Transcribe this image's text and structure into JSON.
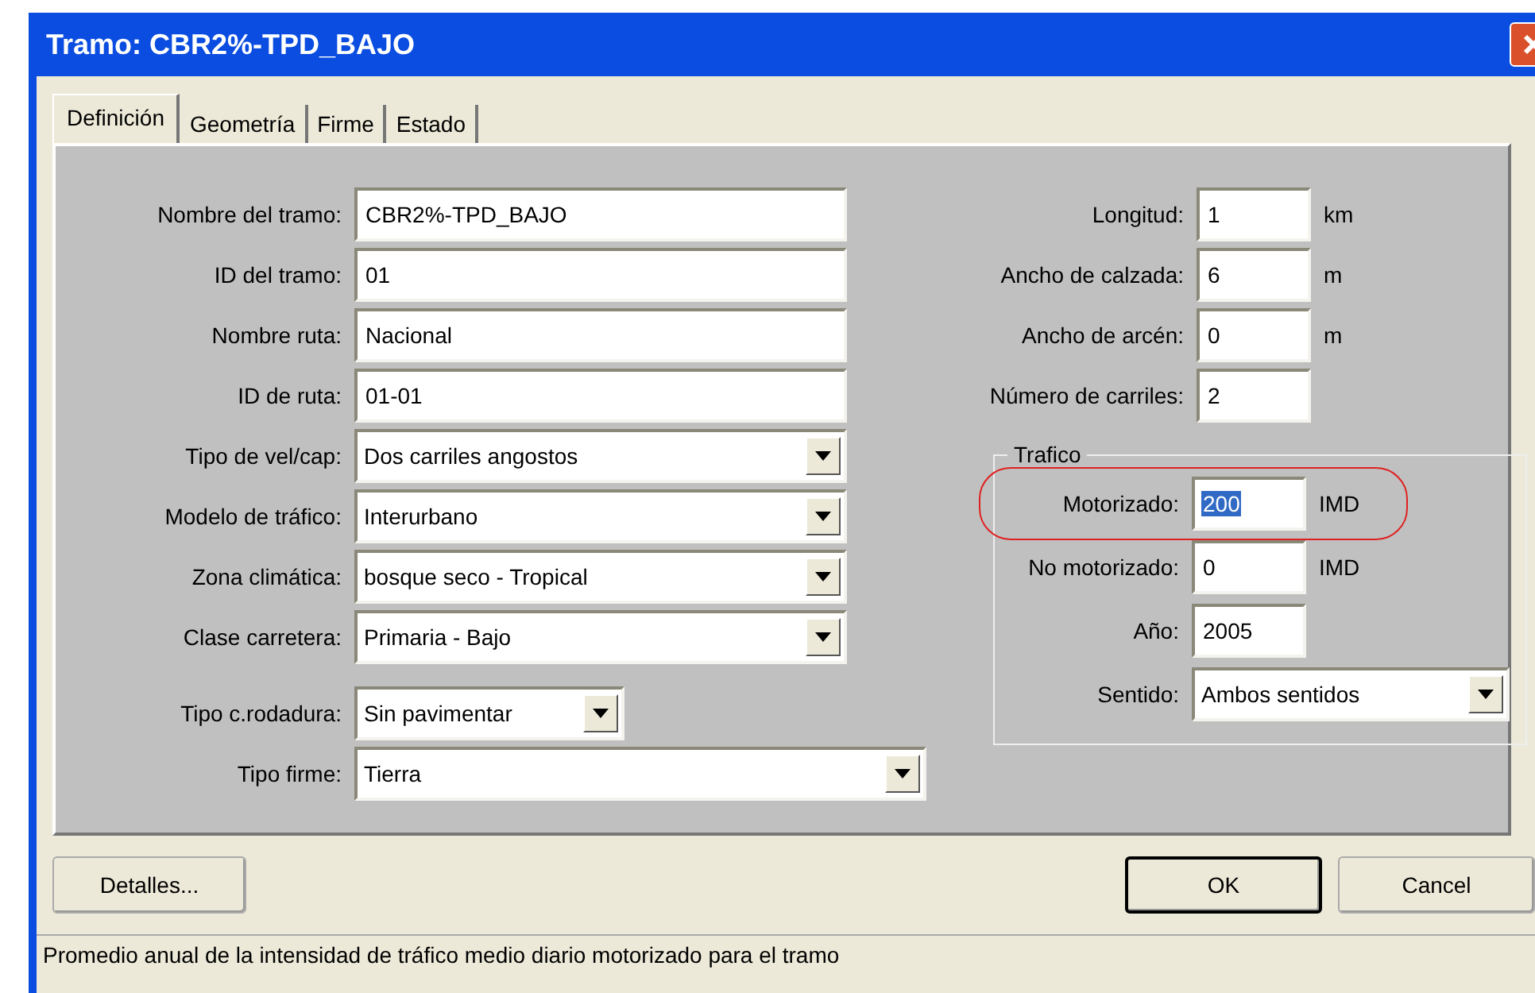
{
  "window": {
    "title": "Tramo: CBR2%-TPD_BAJO"
  },
  "tabs": [
    {
      "label": "Definición",
      "selected": true
    },
    {
      "label": "Geometría",
      "selected": false
    },
    {
      "label": "Firme",
      "selected": false
    },
    {
      "label": "Estado",
      "selected": false
    }
  ],
  "left_fields": [
    {
      "label": "Nombre del tramo:",
      "kind": "text",
      "value": "CBR2%-TPD_BAJO"
    },
    {
      "label": "ID del tramo:",
      "kind": "text",
      "value": "01"
    },
    {
      "label": "Nombre ruta:",
      "kind": "text",
      "value": "Nacional"
    },
    {
      "label": "ID de ruta:",
      "kind": "text",
      "value": "01-01"
    },
    {
      "label": "Tipo de vel/cap:",
      "kind": "dropdown",
      "value": "Dos carriles angostos"
    },
    {
      "label": "Modelo de tráfico:",
      "kind": "dropdown",
      "value": "Interurbano"
    },
    {
      "label": "Zona climática:",
      "kind": "dropdown",
      "value": "bosque seco - Tropical"
    },
    {
      "label": "Clase carretera:",
      "kind": "dropdown",
      "value": "Primaria - Bajo"
    },
    {
      "label": "Tipo c.rodadura:",
      "kind": "dropdown",
      "value": "Sin pavimentar"
    },
    {
      "label": "Tipo firme:",
      "kind": "dropdown",
      "value": "Tierra"
    }
  ],
  "right_fields": [
    {
      "label": "Longitud:",
      "value": "1",
      "unit": "km"
    },
    {
      "label": "Ancho de calzada:",
      "value": "6",
      "unit": "m"
    },
    {
      "label": "Ancho de arcén:",
      "value": "0",
      "unit": "m"
    },
    {
      "label": "Número de carriles:",
      "value": "2"
    }
  ],
  "traffic_group": {
    "title": "Trafico",
    "fields": [
      {
        "label": "Motorizado:",
        "kind": "text",
        "value": "200",
        "unit": "IMD",
        "text_selected": true,
        "circled": true
      },
      {
        "label": "No motorizado:",
        "kind": "text",
        "value": "0",
        "unit": "IMD"
      },
      {
        "label": "Año:",
        "kind": "text",
        "value": "2005"
      },
      {
        "label": "Sentido:",
        "kind": "dropdown",
        "value": "Ambos sentidos"
      }
    ]
  },
  "buttons": [
    {
      "label": "Detalles...",
      "default": false
    },
    {
      "label": "OK",
      "default": true
    },
    {
      "label": "Cancel",
      "default": false
    }
  ],
  "status_bar": "Promedio anual de la intensidad de tráfico medio diario motorizado para el tramo"
}
